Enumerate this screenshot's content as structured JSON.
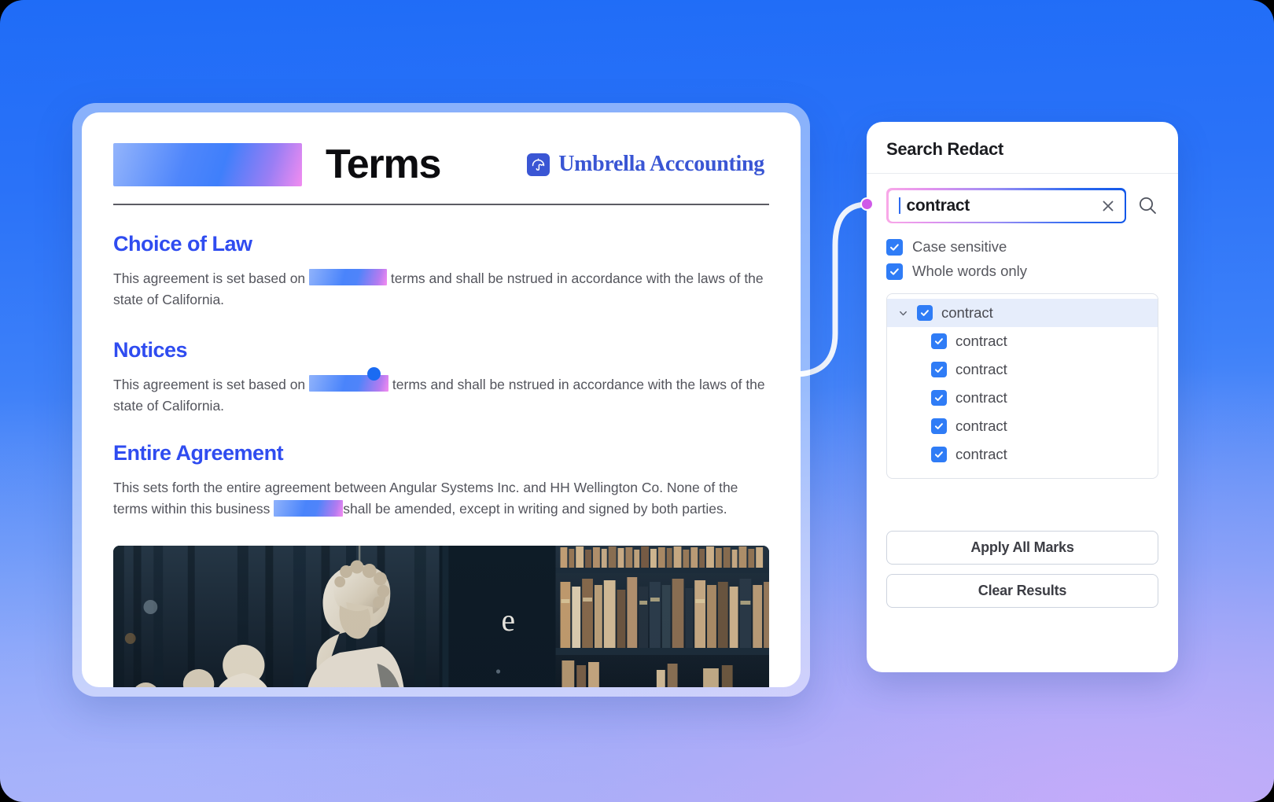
{
  "document": {
    "title": "Terms",
    "brand": {
      "name": "Umbrella Acccounting",
      "icon": "umbrella-icon",
      "color": "#3a56d4"
    },
    "sections": [
      {
        "heading": "Choice of Law",
        "text_before": "This agreement is set based on",
        "redacted": true,
        "text_after": "terms and shall be nstrued in accordance with the laws of the state of California."
      },
      {
        "heading": "Notices",
        "text_before": "This agreement is set based on",
        "redacted": true,
        "text_after": "terms and shall be nstrued in accordance with the laws of the state of California."
      },
      {
        "heading": "Entire Agreement",
        "text_before": "This sets forth the entire agreement between Angular Systems Inc. and HH Wellington Co. None of the terms within this business",
        "redacted": true,
        "text_after": "shall be amended, except in writing and signed by both parties."
      }
    ],
    "photo_alt": "library-bookshelf-busts-photo"
  },
  "panel": {
    "title": "Search Redact",
    "search": {
      "value": "contract",
      "placeholder": "Search",
      "clear_icon": "close-icon",
      "search_icon": "search-icon"
    },
    "options": [
      {
        "label": "Case sensitive",
        "checked": true
      },
      {
        "label": "Whole words only",
        "checked": true
      }
    ],
    "results": {
      "group_label": "contract",
      "group_checked": true,
      "expanded": true,
      "items": [
        {
          "label": "contract",
          "checked": true
        },
        {
          "label": "contract",
          "checked": true
        },
        {
          "label": "contract",
          "checked": true
        },
        {
          "label": "contract",
          "checked": true
        },
        {
          "label": "contract",
          "checked": true
        }
      ]
    },
    "actions": {
      "apply_label": "Apply All Marks",
      "clear_label": "Clear Results"
    }
  },
  "theme": {
    "accent_blue": "#2f6bf0",
    "heading_blue": "#2f4cf0",
    "checkbox_blue": "#2f7cf6",
    "brand_blue": "#3a56d4",
    "connector_pink": "#cf5ae8",
    "connector_blue": "#1a6bf2"
  }
}
